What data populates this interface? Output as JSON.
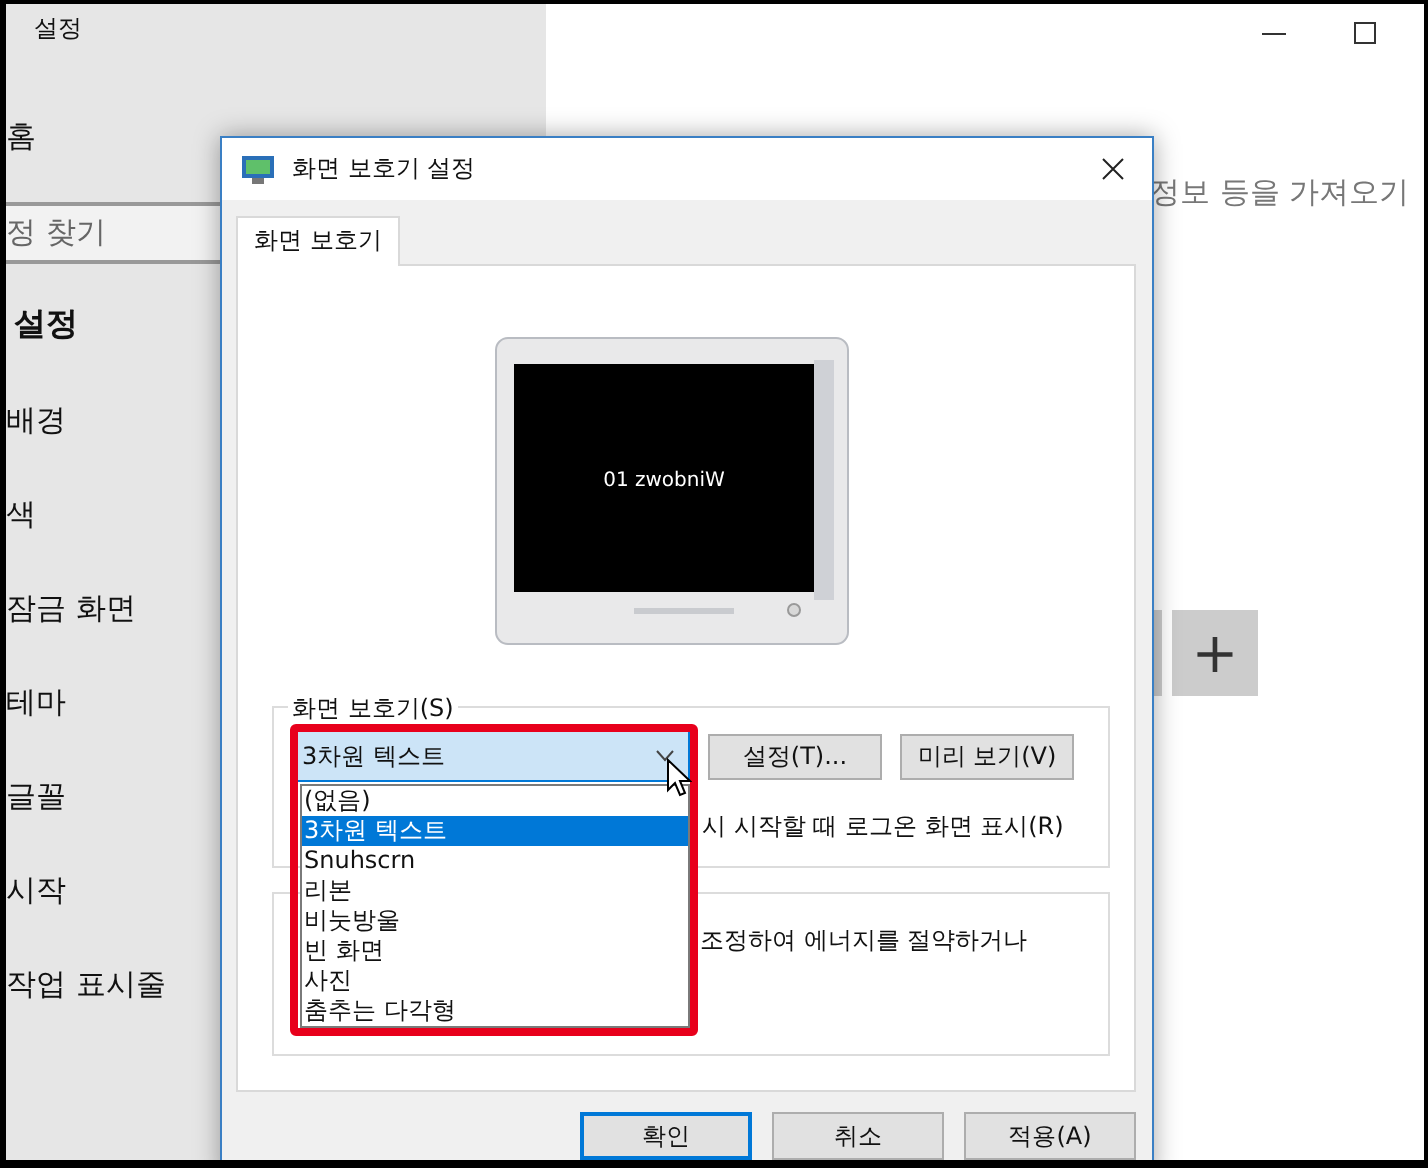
{
  "settings_window": {
    "title": "설정",
    "home": "홈",
    "search": {
      "placeholder": "정 찾기"
    },
    "section": "설정",
    "items": [
      "배경",
      "색",
      "잠금 화면",
      "테마",
      "글꼴",
      "시작",
      "작업 표시줄"
    ],
    "description": "정보 등을 가져오기",
    "add_button": "+"
  },
  "dialog": {
    "title": "화면 보호기 설정",
    "tabs": [
      {
        "label": "화면 보호기",
        "selected": true
      }
    ],
    "preview_text": "01 zwobniW",
    "group_label": "화면 보호기(S)",
    "dropdown": {
      "value": "3차원 텍스트",
      "expanded": true
    },
    "options": [
      {
        "label": "(없음)",
        "selected": false
      },
      {
        "label": "3차원 텍스트",
        "selected": true
      },
      {
        "label": "Snuhscrn",
        "selected": false
      },
      {
        "label": "리본",
        "selected": false
      },
      {
        "label": "비눗방울",
        "selected": false
      },
      {
        "label": "빈 화면",
        "selected": false
      },
      {
        "label": "사진",
        "selected": false
      },
      {
        "label": "춤추는 다각형",
        "selected": false
      }
    ],
    "group_buttons": [
      "설정(T)...",
      "미리 보기(V)"
    ],
    "logon_label": "시 시작할 때 로그온 화면 표시(R)",
    "power_text": "조정하여 에너지를 절약하거나",
    "footer_buttons": [
      {
        "label": "확인",
        "default": true
      },
      {
        "label": "취소",
        "default": false
      },
      {
        "label": "적용(A)",
        "default": false
      }
    ]
  }
}
